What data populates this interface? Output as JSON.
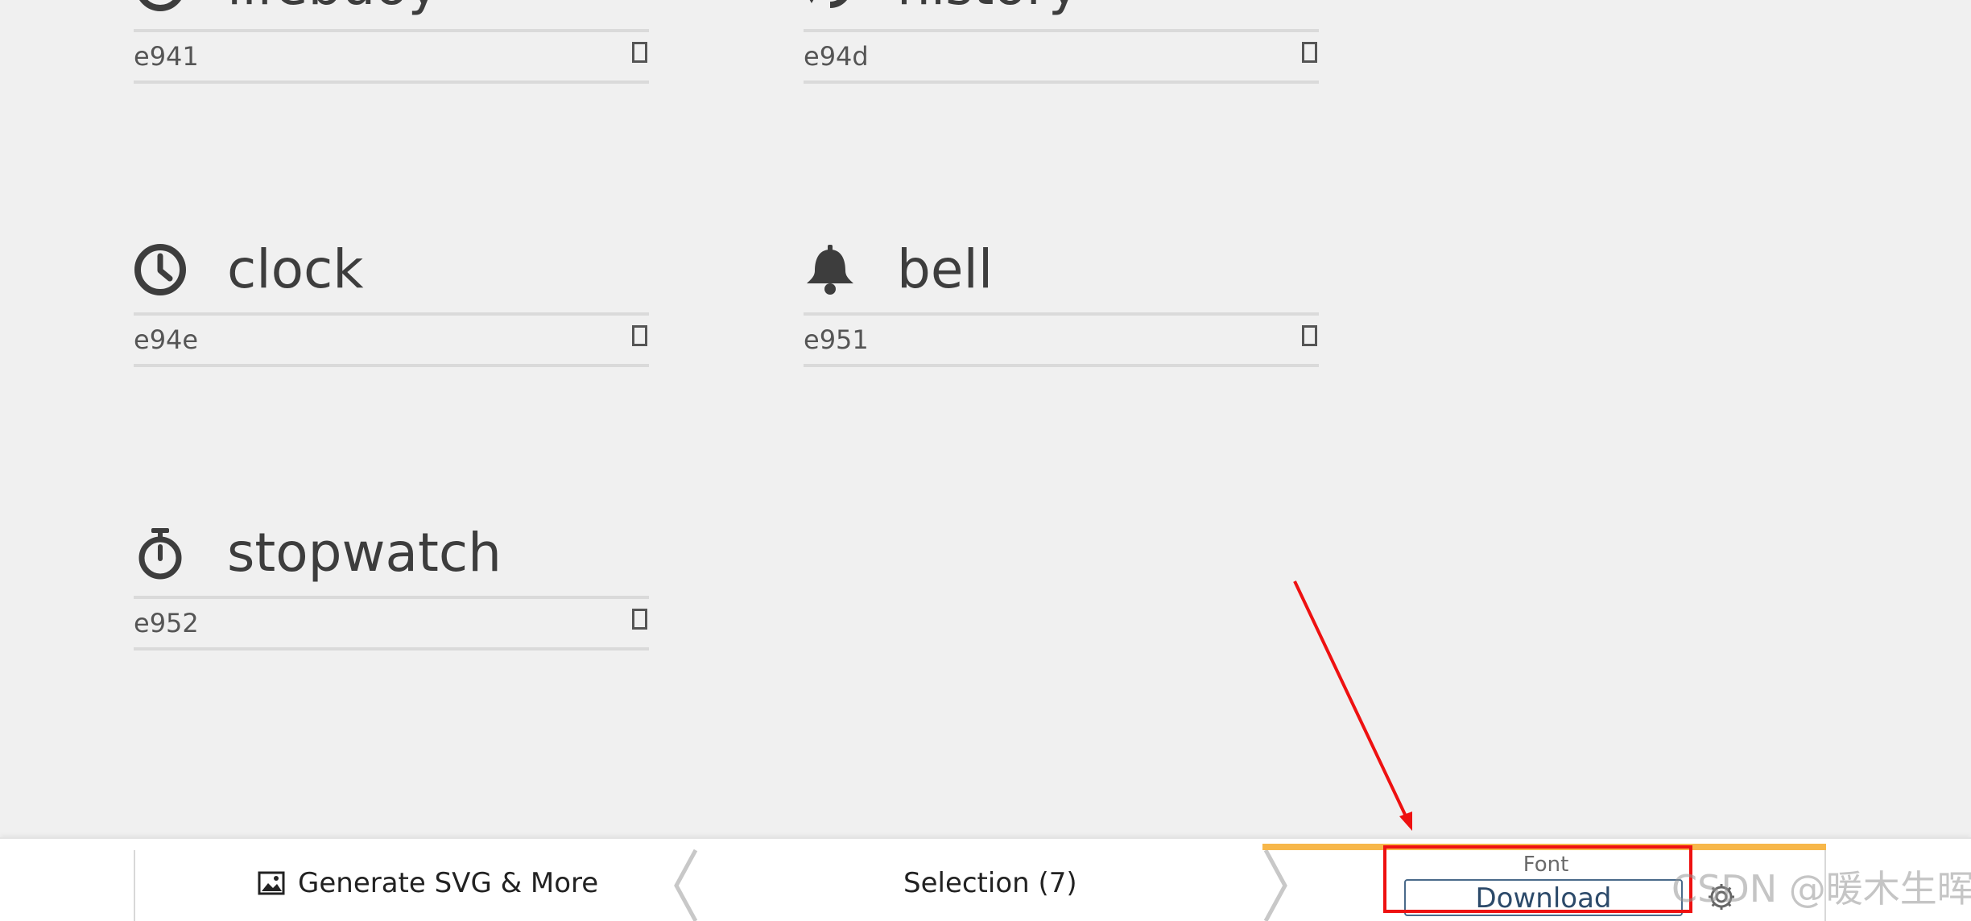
{
  "glyphs": [
    {
      "name": "lifebuoy",
      "code": "e941",
      "icon": "lifebuoy-icon"
    },
    {
      "name": "history",
      "code": "e94d",
      "icon": "history-icon"
    },
    {
      "name": "clock",
      "code": "e94e",
      "icon": "clock-icon"
    },
    {
      "name": "bell",
      "code": "e951",
      "icon": "bell-icon"
    },
    {
      "name": "stopwatch",
      "code": "e952",
      "icon": "stopwatch-icon"
    }
  ],
  "toolbar": {
    "generate_label": "Generate SVG & More",
    "selection_label": "Selection (7)",
    "font_label": "Font",
    "download_label": "Download",
    "gear_icon": "gear-icon",
    "image_icon": "image-icon",
    "accent_color": "#f7b74a"
  },
  "annotation": {
    "highlight_color": "#ee1111"
  },
  "watermark": {
    "text": "CSDN @暖木生晖"
  }
}
